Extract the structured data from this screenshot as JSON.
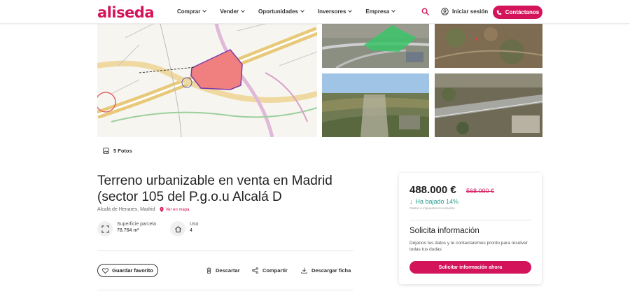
{
  "header": {
    "logo": "aliseda",
    "nav": [
      {
        "label": "Comprar"
      },
      {
        "label": "Vender"
      },
      {
        "label": "Oportunidades"
      },
      {
        "label": "Inversores"
      },
      {
        "label": "Empresa"
      }
    ],
    "login_label": "Iniciar sesión",
    "contact_label": "Contáctanos"
  },
  "colors": {
    "brand": "#d4145a",
    "price_drop": "#2a9d8f"
  },
  "gallery": {
    "photos_count_label": "5 Fotos",
    "icons": [
      "site-plan-map",
      "aerial-photo-green-plot",
      "satellite-photo-terrain",
      "aerial-photo-landscape",
      "aerial-photo-highway"
    ]
  },
  "property": {
    "title": "Terreno urbanizable en venta en Madrid (sector 105 del P.g.o.u Alcalá D",
    "location": "Alcalá de Henares, Madrid",
    "map_link": "Ver en mapa",
    "features": [
      {
        "label": "Superficie parcela",
        "value": "78.764 m²",
        "icon": "area-icon"
      },
      {
        "label": "Uso",
        "value": "4",
        "icon": "home-icon"
      }
    ]
  },
  "actions": {
    "favorite": "Guardar favorito",
    "discard": "Descartar",
    "share": "Compartir",
    "download": "Descargar ficha"
  },
  "price_card": {
    "price": "488.000 €",
    "old_price": "568.000 €",
    "drop_label": "Ha bajado 14%",
    "tax_note": "Gastos e impuestos no incluidos",
    "info_title": "Solicita información",
    "info_text": "Déjanos tus datos y te contactaremos pronto para resolver todas tus dudas",
    "request_button": "Solicitar información ahora"
  }
}
